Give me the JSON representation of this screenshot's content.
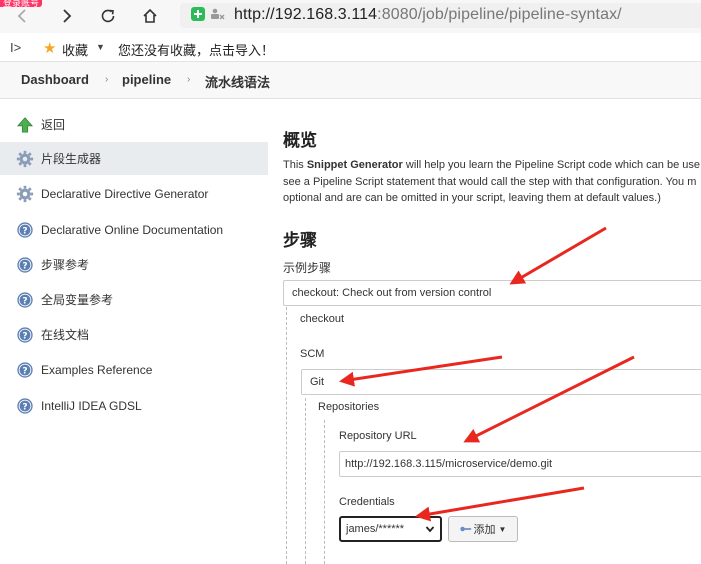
{
  "browser": {
    "url_host": "http://192.168.3.114",
    "url_rest": ":8080/job/pipeline/pipeline-syntax/",
    "corner_badge": "登录账号"
  },
  "bookmarks": {
    "label": "收藏",
    "hint": "您还没有收藏，点击导入！"
  },
  "breadcrumb": [
    "Dashboard",
    "pipeline",
    "流水线语法"
  ],
  "sidebar": {
    "items": [
      {
        "label": "返回",
        "icon": "up-arrow-icon"
      },
      {
        "label": "片段生成器",
        "icon": "gear-icon"
      },
      {
        "label": "Declarative Directive Generator",
        "icon": "gear-icon"
      },
      {
        "label": "Declarative Online Documentation",
        "icon": "help-icon"
      },
      {
        "label": "步骤参考",
        "icon": "help-icon"
      },
      {
        "label": "全局变量参考",
        "icon": "help-icon"
      },
      {
        "label": "在线文档",
        "icon": "help-icon"
      },
      {
        "label": "Examples Reference",
        "icon": "help-icon"
      },
      {
        "label": "IntelliJ IDEA GDSL",
        "icon": "help-icon"
      }
    ]
  },
  "main": {
    "title": "概览",
    "desc": {
      "p1": "This ",
      "strong": "Snippet Generator",
      "p2": " will help you learn the Pipeline Script code which can be use",
      "line2": "see a Pipeline Script statement that would call the step with that configuration. You m",
      "line3": "optional and are can be omitted in your script, leaving them at default values.)"
    },
    "steps_title": "步骤",
    "sample_label": "示例步骤",
    "sample_value": "checkout: Check out from version control",
    "checkout_label": "checkout",
    "scm_label": "SCM",
    "scm_value": "Git",
    "repositories_label": "Repositories",
    "repo_url_label": "Repository URL",
    "repo_url_value": "http://192.168.3.115/microservice/demo.git",
    "credentials_label": "Credentials",
    "credentials_value": "james/******",
    "add_button": "添加"
  },
  "colors": {
    "annotation_arrow": "#e8281e",
    "active_sidebar": "#e9ecef",
    "help_icon": "#4a6fa5",
    "gear_icon": "#5a7fb0"
  }
}
